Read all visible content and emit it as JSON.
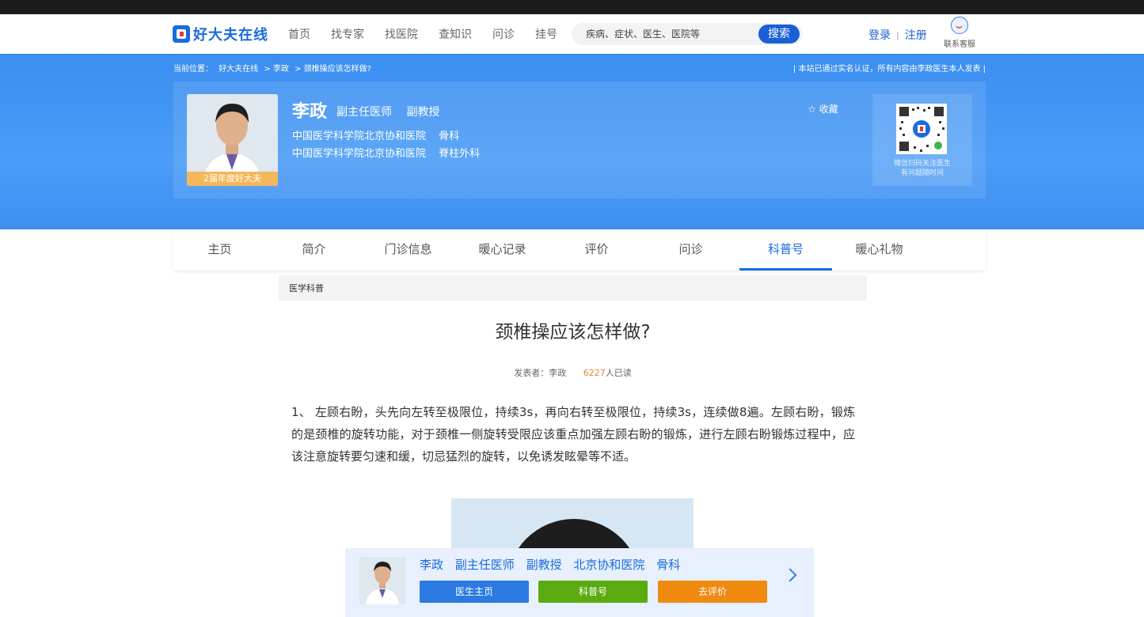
{
  "header": {
    "logo": "好大夫在线",
    "nav": [
      "首页",
      "找专家",
      "找医院",
      "查知识",
      "问诊",
      "挂号"
    ],
    "search_placeholder": "疾病、症状、医生、医院等",
    "search_button": "搜索",
    "login": "登录",
    "register": "注册",
    "service": "联系客服"
  },
  "banner": {
    "breadcrumb": [
      "当前位置：",
      "好大夫在线",
      "> 李政",
      "> 颈椎操应该怎样做?"
    ],
    "verify_notice": "|   本站已通过实名认证，所有内容由李政医生本人发表   |",
    "doctor_name": "李政",
    "titles": [
      "副主任医师",
      "副教授"
    ],
    "hospitals": [
      {
        "hospital": "中国医学科学院北京协和医院",
        "dept": "骨科"
      },
      {
        "hospital": "中国医学科学院北京协和医院",
        "dept": "脊柱外科"
      }
    ],
    "award": "2届年度好大夫",
    "favorite": "☆ 收藏",
    "qr_text_1": "微信扫码关注医生",
    "qr_text_2": "有问题随时问"
  },
  "tabs": [
    "主页",
    "简介",
    "门诊信息",
    "暖心记录",
    "评价",
    "问诊",
    "科普号",
    "暖心礼物"
  ],
  "active_tab": "科普号",
  "article": {
    "section": "医学科普",
    "title": "颈椎操应该怎样做?",
    "author_label": "发表者：李政",
    "read_count": "6227",
    "read_suffix": "人已读",
    "body": "1、 左顾右盼，头先向左转至极限位，持续3s，再向右转至极限位，持续3s，连续做8遍。左顾右盼，锻炼的是颈椎的旋转功能，对于颈椎一侧旋转受限应该重点加强左顾右盼的锻炼，进行左顾右盼锻炼过程中，应该注意旋转要匀速和缓，切忌猛烈的旋转，以免诱发眩晕等不适。"
  },
  "float_bar": {
    "name": "李政",
    "title1": "副主任医师",
    "title2": "副教授",
    "hospital": "北京协和医院",
    "dept": "骨科",
    "buttons": [
      {
        "label": "医生主页",
        "color": "#2a7ae2"
      },
      {
        "label": "科普号",
        "color": "#5aab0f"
      },
      {
        "label": "去评价",
        "color": "#f08a0f"
      }
    ]
  }
}
